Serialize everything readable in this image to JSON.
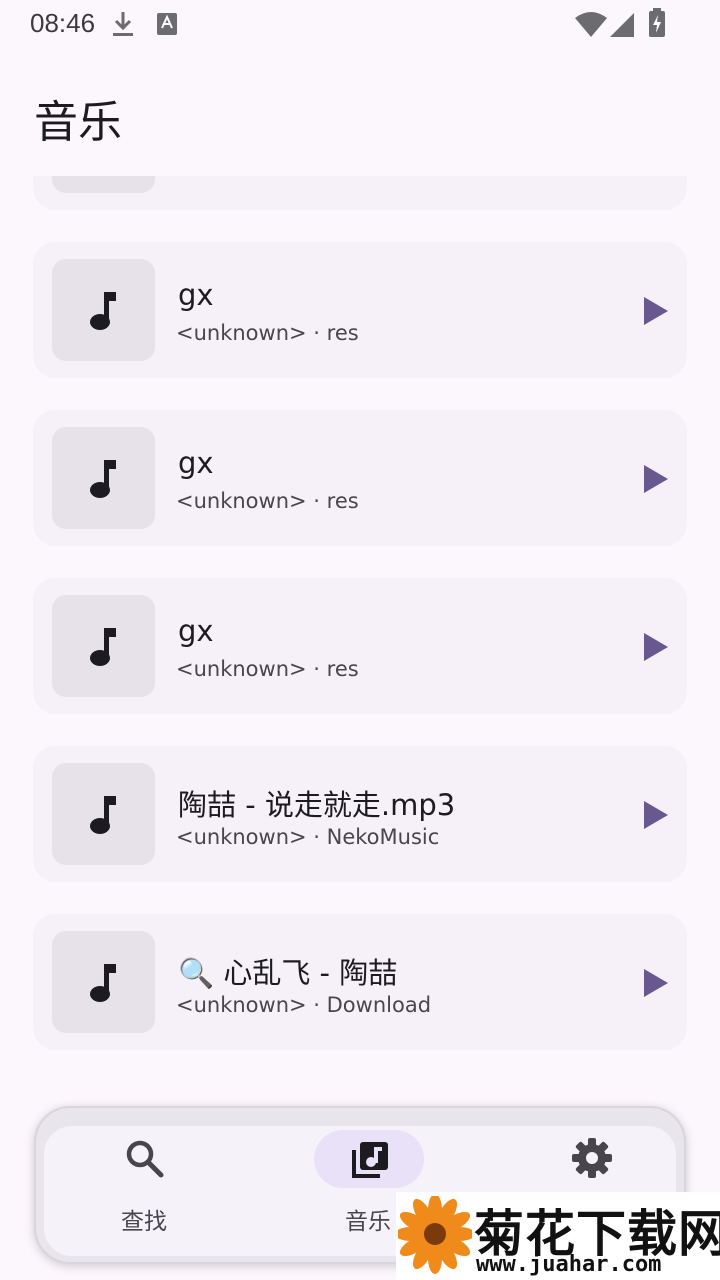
{
  "status_bar": {
    "time": "08:46",
    "icons": [
      "download-icon",
      "keyboard-a-icon",
      "wifi-icon",
      "signal-icon",
      "battery-charging-icon"
    ]
  },
  "header": {
    "title": "音乐"
  },
  "songs": [
    {
      "title": "gx",
      "subtitle": "<unknown> · res"
    },
    {
      "title": "gx",
      "subtitle": "<unknown> · res"
    },
    {
      "title": "gx",
      "subtitle": "<unknown> · res"
    },
    {
      "title": "陶喆 - 说走就走.mp3",
      "subtitle": "<unknown> · NekoMusic"
    },
    {
      "title": "🔍 心乱飞 - 陶喆",
      "subtitle": "<unknown> · Download"
    }
  ],
  "bottom_nav": {
    "items": [
      {
        "label": "查找",
        "icon": "search-icon",
        "active": false
      },
      {
        "label": "音乐",
        "icon": "library-music-icon",
        "active": true
      },
      {
        "label": "设置",
        "icon": "gear-icon",
        "active": false
      }
    ]
  },
  "watermark": {
    "title": "菊花下载网",
    "url": "www.juahar.com"
  },
  "colors": {
    "background": "#fcf7fd",
    "card": "#f6f1f8",
    "accent": "#67598f",
    "nav_active_pill": "#e9e1f7"
  }
}
